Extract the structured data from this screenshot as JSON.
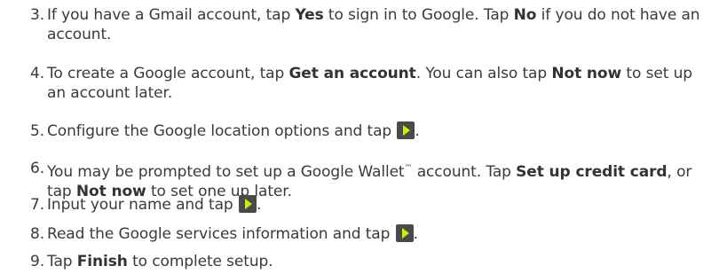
{
  "steps": [
    {
      "num": "3.",
      "t1": "If you have a Gmail account, tap ",
      "b1": "Yes",
      "t2": " to sign in to Google. Tap ",
      "b2": "No",
      "t3": " if you do not have an account."
    },
    {
      "num": "4.",
      "t1": "To create a Google account, tap ",
      "b1": "Get an account",
      "t2": ". You can also tap ",
      "b2": "Not now",
      "t3": " to set up an account later."
    },
    {
      "num": "5.",
      "t1": "Configure the Google location options and tap ",
      "icon": "next-arrow-icon",
      "t2": "."
    },
    {
      "num": "6.",
      "t1": "You may be prompted to set up a Google Wallet",
      "tm": "™",
      "t2": " account. Tap ",
      "b1": "Set up credit card",
      "t3": ", or tap ",
      "b2": "Not now",
      "t4": " to set one up later."
    },
    {
      "num": "7.",
      "t1": "Input your name and tap ",
      "icon": "next-arrow-icon",
      "t2": "."
    },
    {
      "num": "8.",
      "t1": "Read the Google services information and tap ",
      "icon": "next-arrow-icon",
      "t2": "."
    },
    {
      "num": "9.",
      "t1": "Tap ",
      "b1": "Finish",
      "t2": " to complete setup."
    }
  ],
  "icon_colors": {
    "background": "#4a4a4a",
    "arrow": "#c8f000"
  }
}
